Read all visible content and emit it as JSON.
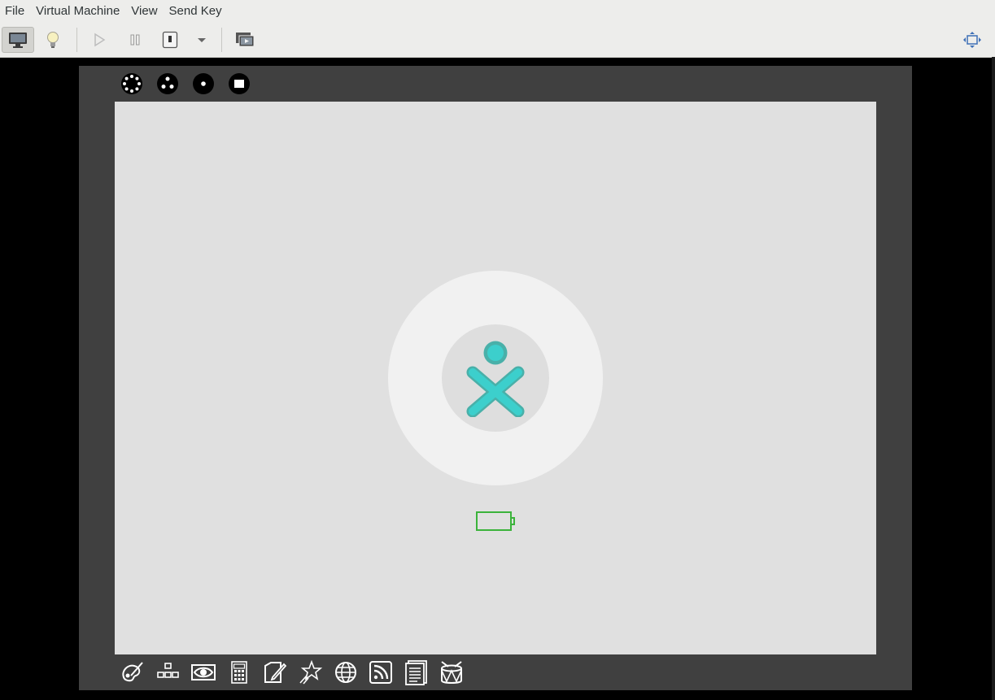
{
  "menubar": {
    "items": [
      "File",
      "Virtual Machine",
      "View",
      "Send Key"
    ]
  },
  "toolbar": {
    "buttons": [
      {
        "name": "show-console",
        "icon": "monitor-icon",
        "active": true
      },
      {
        "name": "show-details",
        "icon": "lightbulb-icon",
        "active": false
      },
      {
        "name": "run",
        "icon": "play-icon",
        "active": false
      },
      {
        "name": "pause",
        "icon": "pause-icon",
        "active": false
      },
      {
        "name": "shutdown",
        "icon": "power-icon",
        "active": false
      },
      {
        "name": "shutdown-menu",
        "icon": "chevron-down-icon",
        "active": false
      },
      {
        "name": "snapshots",
        "icon": "snapshots-icon",
        "active": false
      },
      {
        "name": "fullscreen",
        "icon": "fullscreen-icon",
        "active": false
      }
    ]
  },
  "guest": {
    "os": "Sugar desktop",
    "zoom_icons": [
      "neighborhood-view-icon",
      "group-view-icon",
      "home-view-icon",
      "activity-view-icon"
    ],
    "battery_icon": "battery-icon",
    "xo_icon": "xo-buddy-icon",
    "dock_icons": [
      "paint-activity-icon",
      "turtleblocks-activity-icon",
      "record-activity-icon",
      "calculate-activity-icon",
      "write-activity-icon",
      "fototoon-activity-icon",
      "browse-activity-icon",
      "news-reader-activity-icon",
      "read-activity-icon",
      "tamtam-activity-icon"
    ]
  },
  "colors": {
    "xo_fill": "#3ccfcc",
    "xo_stroke": "#49b0a9",
    "battery": "#3bb33b",
    "frame": "#404040",
    "screen": "#e0e0e0"
  },
  "footer_text": ""
}
